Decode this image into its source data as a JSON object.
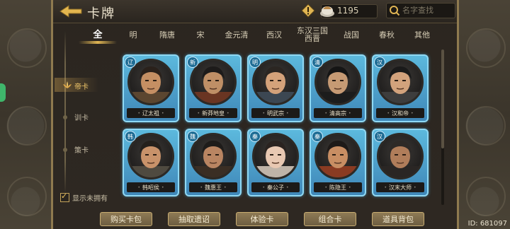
{
  "header": {
    "title": "卡牌",
    "back_icon": "back-arrow-icon",
    "warning_icon": "warning-icon",
    "coin_icon": "treasure-icon",
    "coin_value": "1195",
    "search_placeholder": "名字查找"
  },
  "tabs": [
    {
      "label": "全",
      "active": true
    },
    {
      "label": "明"
    },
    {
      "label": "隋唐"
    },
    {
      "label": "宋"
    },
    {
      "label": "金元清"
    },
    {
      "label": "西汉"
    },
    {
      "label": "东汉三国\n西晋"
    },
    {
      "label": "战国"
    },
    {
      "label": "春秋"
    },
    {
      "label": "其他"
    }
  ],
  "subnav": [
    {
      "label": "帝卡",
      "active": true
    },
    {
      "label": "训卡"
    },
    {
      "label": "策卡"
    }
  ],
  "cards": [
    {
      "badge": "辽",
      "name": "辽太祖"
    },
    {
      "badge": "新",
      "name": "新莽地皇"
    },
    {
      "badge": "明",
      "name": "明武宗"
    },
    {
      "badge": "清",
      "name": "清高宗"
    },
    {
      "badge": "汉",
      "name": "汉和帝"
    },
    {
      "badge": "韩",
      "name": "韩昭侯"
    },
    {
      "badge": "魏",
      "name": "魏惠王"
    },
    {
      "badge": "秦",
      "name": "秦公子"
    },
    {
      "badge": "秦",
      "name": "陈隐王"
    },
    {
      "badge": "汉",
      "name": "汉末大师"
    }
  ],
  "show_unowned": {
    "label": "显示未拥有",
    "checked": true
  },
  "bottom_buttons": [
    "购买卡包",
    "抽取遗诏",
    "体验卡",
    "组合卡",
    "道具背包"
  ],
  "id_label": "ID: 681097",
  "colors": {
    "card_border": "#8fd8f3",
    "accent_gold": "#e0b553",
    "board_bg": "#2b2620"
  }
}
